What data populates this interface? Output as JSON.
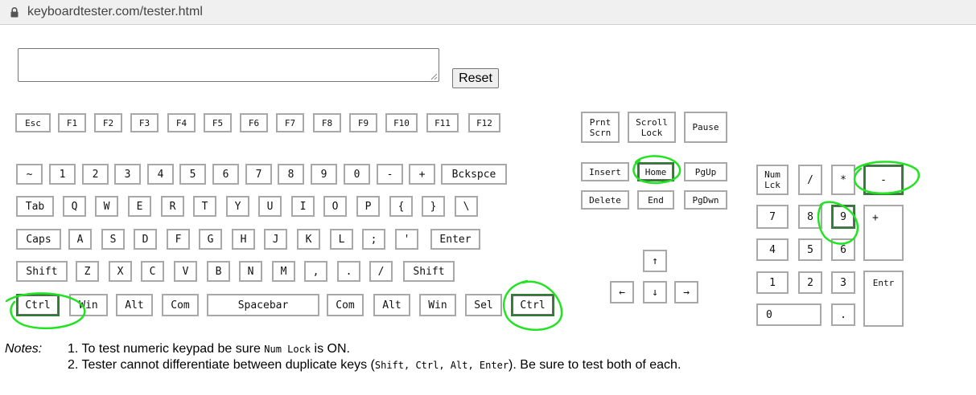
{
  "browser": {
    "url": "keyboardtester.com/tester.html"
  },
  "controls": {
    "reset_label": "Reset",
    "textarea_value": ""
  },
  "function_row": [
    {
      "id": "esc",
      "label": "Esc"
    },
    {
      "id": "f1",
      "label": "F1"
    },
    {
      "id": "f2",
      "label": "F2"
    },
    {
      "id": "f3",
      "label": "F3"
    },
    {
      "id": "f4",
      "label": "F4"
    },
    {
      "id": "f5",
      "label": "F5"
    },
    {
      "id": "f6",
      "label": "F6"
    },
    {
      "id": "f7",
      "label": "F7"
    },
    {
      "id": "f8",
      "label": "F8"
    },
    {
      "id": "f9",
      "label": "F9"
    },
    {
      "id": "f10",
      "label": "F10"
    },
    {
      "id": "f11",
      "label": "F11"
    },
    {
      "id": "f12",
      "label": "F12"
    }
  ],
  "number_row": [
    {
      "id": "tilde",
      "label": "~"
    },
    {
      "id": "1",
      "label": "1"
    },
    {
      "id": "2",
      "label": "2"
    },
    {
      "id": "3",
      "label": "3"
    },
    {
      "id": "4",
      "label": "4"
    },
    {
      "id": "5",
      "label": "5"
    },
    {
      "id": "6",
      "label": "6"
    },
    {
      "id": "7",
      "label": "7"
    },
    {
      "id": "8",
      "label": "8"
    },
    {
      "id": "9",
      "label": "9"
    },
    {
      "id": "0",
      "label": "0"
    },
    {
      "id": "minus",
      "label": "-"
    },
    {
      "id": "plus",
      "label": "+"
    },
    {
      "id": "backspace",
      "label": "Bckspce"
    }
  ],
  "qwerty_row": [
    {
      "id": "tab",
      "label": "Tab"
    },
    {
      "id": "q",
      "label": "Q"
    },
    {
      "id": "w",
      "label": "W"
    },
    {
      "id": "e",
      "label": "E"
    },
    {
      "id": "r",
      "label": "R"
    },
    {
      "id": "t",
      "label": "T"
    },
    {
      "id": "y",
      "label": "Y"
    },
    {
      "id": "u",
      "label": "U"
    },
    {
      "id": "i",
      "label": "I"
    },
    {
      "id": "o",
      "label": "O"
    },
    {
      "id": "p",
      "label": "P"
    },
    {
      "id": "lbrace",
      "label": "{"
    },
    {
      "id": "rbrace",
      "label": "}"
    },
    {
      "id": "backslash",
      "label": "\\"
    }
  ],
  "home_row": [
    {
      "id": "caps",
      "label": "Caps"
    },
    {
      "id": "a",
      "label": "A"
    },
    {
      "id": "s",
      "label": "S"
    },
    {
      "id": "d",
      "label": "D"
    },
    {
      "id": "f",
      "label": "F"
    },
    {
      "id": "g",
      "label": "G"
    },
    {
      "id": "h",
      "label": "H"
    },
    {
      "id": "j",
      "label": "J"
    },
    {
      "id": "k",
      "label": "K"
    },
    {
      "id": "l",
      "label": "L"
    },
    {
      "id": "semicolon",
      "label": ";"
    },
    {
      "id": "quote",
      "label": "'"
    },
    {
      "id": "enter",
      "label": "Enter"
    }
  ],
  "shift_row": [
    {
      "id": "lshift",
      "label": "Shift"
    },
    {
      "id": "z",
      "label": "Z"
    },
    {
      "id": "x",
      "label": "X"
    },
    {
      "id": "c",
      "label": "C"
    },
    {
      "id": "v",
      "label": "V"
    },
    {
      "id": "b",
      "label": "B"
    },
    {
      "id": "n",
      "label": "N"
    },
    {
      "id": "m",
      "label": "M"
    },
    {
      "id": "comma",
      "label": ","
    },
    {
      "id": "period",
      "label": "."
    },
    {
      "id": "slash",
      "label": "/"
    },
    {
      "id": "rshift",
      "label": "Shift"
    }
  ],
  "bottom_row": [
    {
      "id": "lctrl",
      "label": "Ctrl",
      "highlighted": true
    },
    {
      "id": "lwin",
      "label": "Win"
    },
    {
      "id": "lalt",
      "label": "Alt"
    },
    {
      "id": "lcom",
      "label": "Com"
    },
    {
      "id": "space",
      "label": "Spacebar"
    },
    {
      "id": "rcom",
      "label": "Com"
    },
    {
      "id": "ralt",
      "label": "Alt"
    },
    {
      "id": "rwin",
      "label": "Win"
    },
    {
      "id": "sel",
      "label": "Sel"
    },
    {
      "id": "rctrl",
      "label": "Ctrl",
      "highlighted": true
    }
  ],
  "system_keys": [
    {
      "id": "prntscrn",
      "label": "Prnt\nScrn"
    },
    {
      "id": "scrolllock",
      "label": "Scroll\nLock"
    },
    {
      "id": "pause",
      "label": "Pause"
    }
  ],
  "nav_keys": [
    {
      "id": "insert",
      "label": "Insert"
    },
    {
      "id": "home",
      "label": "Home",
      "highlighted": true
    },
    {
      "id": "pgup",
      "label": "PgUp"
    },
    {
      "id": "delete",
      "label": "Delete"
    },
    {
      "id": "end",
      "label": "End"
    },
    {
      "id": "pgdn",
      "label": "PgDwn"
    }
  ],
  "arrow_keys": [
    {
      "id": "up",
      "label": "↑"
    },
    {
      "id": "left",
      "label": "←"
    },
    {
      "id": "down",
      "label": "↓"
    },
    {
      "id": "right",
      "label": "→"
    }
  ],
  "numpad": [
    {
      "id": "numlock",
      "label": "Num\nLck"
    },
    {
      "id": "np-div",
      "label": "/"
    },
    {
      "id": "np-mul",
      "label": "*"
    },
    {
      "id": "np-minus",
      "label": "-",
      "highlighted": true
    },
    {
      "id": "np7",
      "label": "7"
    },
    {
      "id": "np8",
      "label": "8"
    },
    {
      "id": "np9",
      "label": "9",
      "highlighted": true
    },
    {
      "id": "np-plus",
      "label": "+"
    },
    {
      "id": "np4",
      "label": "4"
    },
    {
      "id": "np5",
      "label": "5"
    },
    {
      "id": "np6",
      "label": "6"
    },
    {
      "id": "np1",
      "label": "1"
    },
    {
      "id": "np2",
      "label": "2"
    },
    {
      "id": "np3",
      "label": "3"
    },
    {
      "id": "np-enter",
      "label": "Entr"
    },
    {
      "id": "np0",
      "label": "0"
    },
    {
      "id": "np-dot",
      "label": "."
    }
  ],
  "notes": {
    "label": "Notes:",
    "line1_before": "1. To test numeric keypad be sure ",
    "line1_code": "Num Lock",
    "line1_after": " is ON.",
    "line2_before": "2. Tester cannot differentiate between duplicate keys (",
    "line2_code": "Shift, Ctrl, Alt, Enter",
    "line2_after": "). Be sure to test both of each."
  },
  "colors": {
    "key_border": "#a8a8a8",
    "pressed_border": "#2e7d32",
    "annotation_green": "#22e322"
  }
}
